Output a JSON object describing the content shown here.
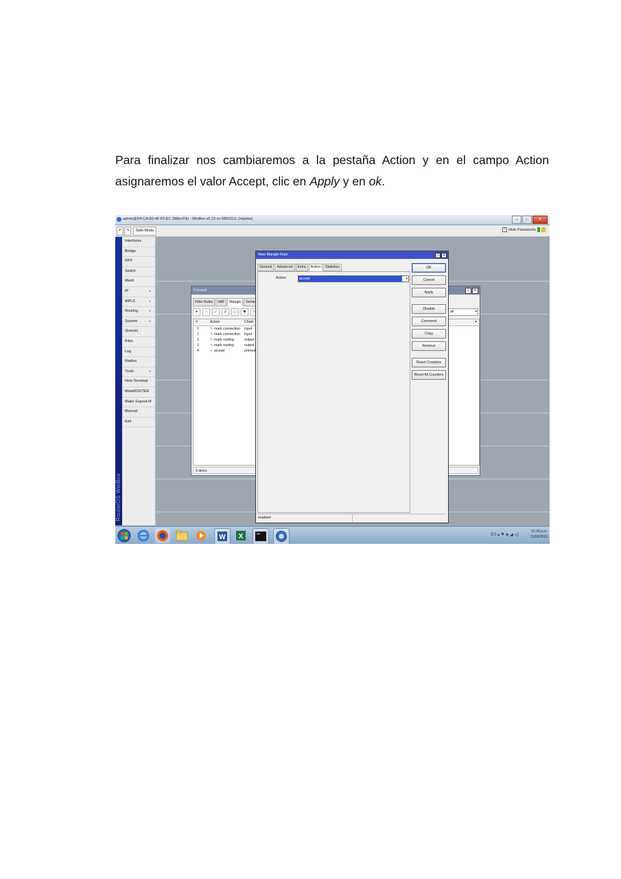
{
  "paragraph": {
    "line1": "Para finalizar nos cambiaremos a la pestaña Action y en el campo Action",
    "line2_prefix": "asignaremos el valor Accept, clic en ",
    "apply": "Apply",
    "line2_mid": " y en ",
    "ok": "ok",
    "line2_suffix": "."
  },
  "winbox": {
    "title": "admin@D4:CA:6D:4F:F0:EC (MikroTik) - WinBox v5.23 on RB2011L (mipsbe)",
    "safe_mode": "Safe Mode",
    "hide_passwords": "Hide Passwords",
    "sidebar_brand": "RouterOS WinBox",
    "menu": [
      {
        "label": "Interfaces",
        "arrow": ""
      },
      {
        "label": "Bridge",
        "arrow": ""
      },
      {
        "label": "PPP",
        "arrow": ""
      },
      {
        "label": "Switch",
        "arrow": ""
      },
      {
        "label": "Mesh",
        "arrow": ""
      },
      {
        "label": "IP",
        "arrow": "▸"
      },
      {
        "label": "MPLS",
        "arrow": "▸"
      },
      {
        "label": "Routing",
        "arrow": "▸"
      },
      {
        "label": "System",
        "arrow": "▸"
      },
      {
        "label": "Queues",
        "arrow": ""
      },
      {
        "label": "Files",
        "arrow": ""
      },
      {
        "label": "Log",
        "arrow": ""
      },
      {
        "label": "Radius",
        "arrow": ""
      },
      {
        "label": "Tools",
        "arrow": "▸"
      },
      {
        "label": "New Terminal",
        "arrow": ""
      },
      {
        "label": "MetaROUTER",
        "arrow": ""
      },
      {
        "label": "Make Supout.rif",
        "arrow": ""
      },
      {
        "label": "Manual",
        "arrow": ""
      },
      {
        "label": "Exit",
        "arrow": ""
      }
    ]
  },
  "firewall": {
    "title": "Firewall",
    "tabs": [
      "Filter Rules",
      "NAT",
      "Mangle",
      "Service P"
    ],
    "active_tab": "Mangle",
    "filter_value": "all",
    "columns": [
      "#",
      "Action",
      "Chain"
    ],
    "rows": [
      {
        "num": "0",
        "action": "mark connection",
        "chain": "input"
      },
      {
        "num": "1",
        "action": "mark connection",
        "chain": "input"
      },
      {
        "num": "2",
        "action": "mark routing",
        "chain": "output"
      },
      {
        "num": "3",
        "action": "mark routing",
        "chain": "output"
      },
      {
        "num": "4",
        "action": "accept",
        "chain": "prerouti"
      }
    ],
    "status": "5 items"
  },
  "dialog": {
    "title": "New Mangle Rule",
    "tabs": [
      "General",
      "Advanced",
      "Extra",
      "Action",
      "Statistics"
    ],
    "active_tab": "Action",
    "action_label": "Action:",
    "action_value": "accept",
    "buttons": [
      "OK",
      "Cancel",
      "Apply",
      "Disable",
      "Comment",
      "Copy",
      "Remove",
      "Reset Counters",
      "Reset All Counters"
    ],
    "status": "enabled"
  },
  "taskbar": {
    "lang": "ES",
    "time": "01:38 p.m.",
    "date": "21/06/2013"
  },
  "colors": {
    "dialog_title": "#3d52c8",
    "sidebar_stripe": "#1b2f9a",
    "selection": "#2f52d4"
  }
}
